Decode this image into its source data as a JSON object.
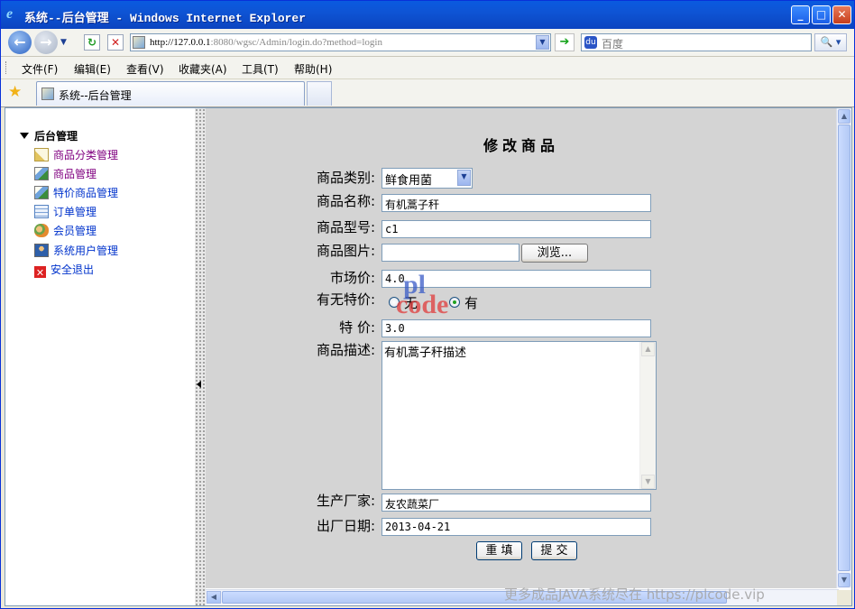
{
  "window": {
    "title": "系统--后台管理 - Windows Internet Explorer",
    "minimize": "_",
    "maximize": "□",
    "close": "✕"
  },
  "toolbar": {
    "back_icon": "←",
    "forward_icon": "→",
    "refresh_icon": "↻",
    "stop_icon": "✕",
    "url_host": "http://127.0.0.1",
    "url_rest": ":8080/wgsc/Admin/login.do?method=login",
    "go_icon": "➔",
    "search_placeholder": "百度",
    "search_button": "🔍 ▾"
  },
  "menubar": {
    "items": [
      "文件(F)",
      "编辑(E)",
      "查看(V)",
      "收藏夹(A)",
      "工具(T)",
      "帮助(H)"
    ]
  },
  "tabs": {
    "active_label": "系统--后台管理"
  },
  "sidebar": {
    "root_label": "后台管理",
    "items": [
      {
        "label": "商品分类管理",
        "icon": "pencil-note-icon"
      },
      {
        "label": "商品管理",
        "icon": "picture-icon"
      },
      {
        "label": "特价商品管理",
        "icon": "picture-icon"
      },
      {
        "label": "订单管理",
        "icon": "document-list-icon"
      },
      {
        "label": "会员管理",
        "icon": "users-group-icon"
      },
      {
        "label": "系统用户管理",
        "icon": "user-icon"
      },
      {
        "label": "安全退出",
        "icon": "exit-x-icon"
      }
    ]
  },
  "form": {
    "title": "修改商品",
    "category_label": "商品类别:",
    "category_value": "鲜食用菌",
    "name_label": "商品名称:",
    "name_value": "有机蒿子秆",
    "model_label": "商品型号:",
    "model_value": "c1",
    "image_label": "商品图片:",
    "image_value": "",
    "browse_button": "浏览...",
    "market_price_label": "市场价:",
    "market_price_value": "4.0",
    "special_label": "有无特价:",
    "special_no": "无",
    "special_yes": "有",
    "special_selected": "有",
    "special_price_label": "特 价:",
    "special_price_value": "3.0",
    "description_label": "商品描述:",
    "description_value": "有机蒿子秆描述",
    "manufacturer_label": "生产厂家:",
    "manufacturer_value": "友农蔬菜厂",
    "date_label": "出厂日期:",
    "date_value": "2013-04-21",
    "reset_button": "重 填",
    "submit_button": "提 交"
  },
  "watermark": {
    "top": "pl",
    "bottom": "code",
    "footer": "更多成品JAVA系统尽在 https://plcode.vip"
  },
  "colors": {
    "titlebar": "#0b4fd2",
    "content_background": "#d4d4d4",
    "link": "#0033cc",
    "visited_link": "#800080"
  }
}
